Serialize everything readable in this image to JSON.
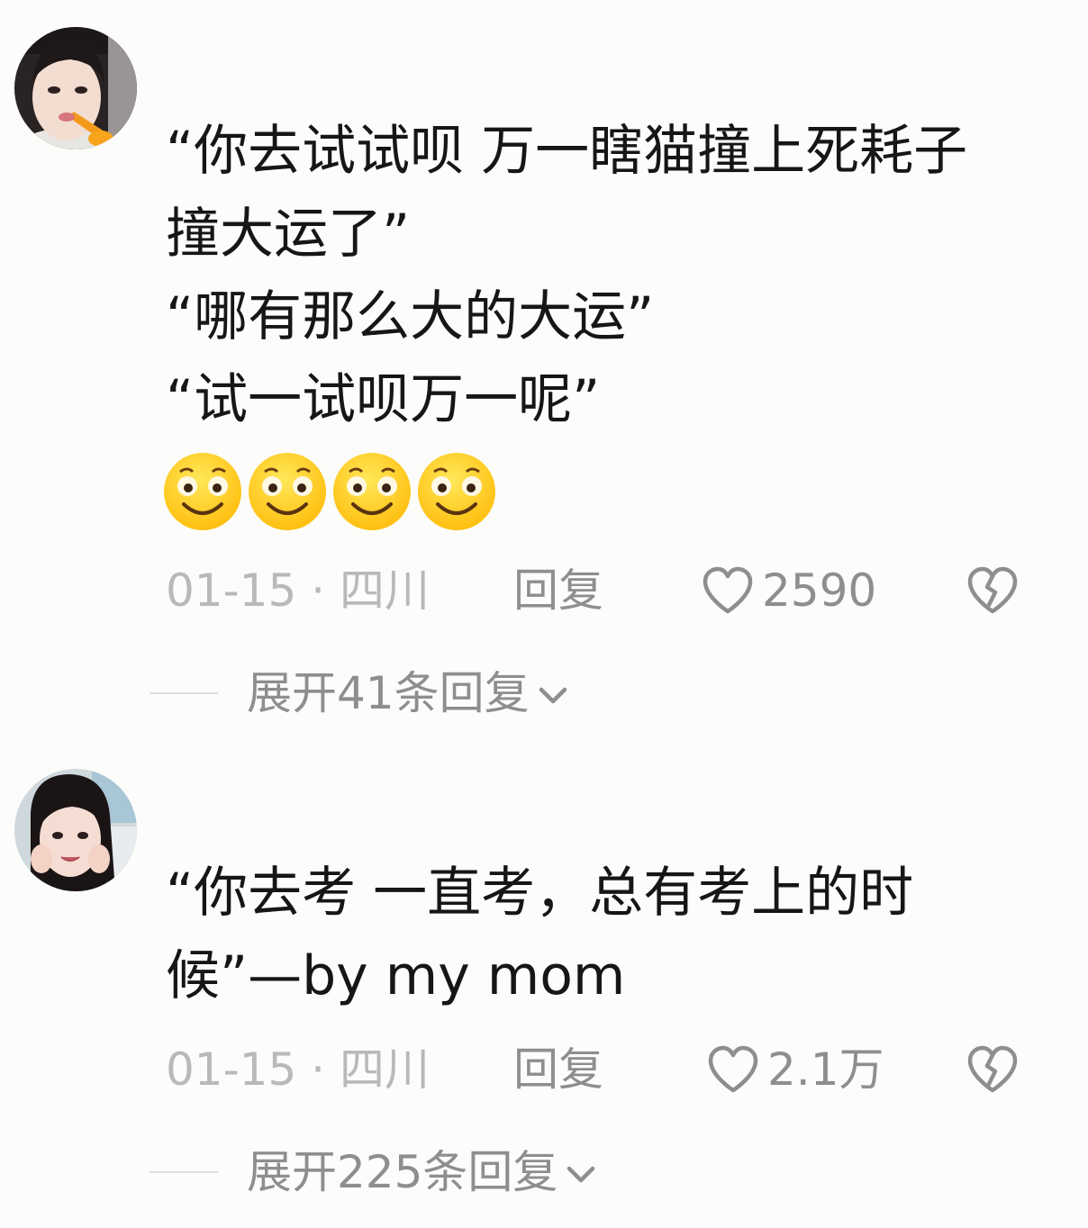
{
  "comments": [
    {
      "lines": [
        "“你去试试呗 万一瞎猫撞上死耗子",
        "撞大运了”",
        "“哪有那么大的大运”",
        "“试一试呗万一呢”"
      ],
      "emojis": [
        "smiling-face-emoji",
        "smiling-face-emoji",
        "smiling-face-emoji",
        "smiling-face-emoji"
      ],
      "date": "01-15 · 四川",
      "reply_label": "回复",
      "likes": "2590",
      "expand_label": "展开41条回复"
    },
    {
      "lines": [
        "“你去考 一直考，总有考上的时",
        "候”—by my mom"
      ],
      "date": "01-15 · 四川",
      "reply_label": "回复",
      "likes": "2.1万",
      "expand_label": "展开225条回复"
    }
  ],
  "colors": {
    "text": "#161616",
    "meta_gray": "#b9b9b9",
    "action_gray": "#8e8e8e",
    "emoji_yellow": "#ffd21f"
  }
}
